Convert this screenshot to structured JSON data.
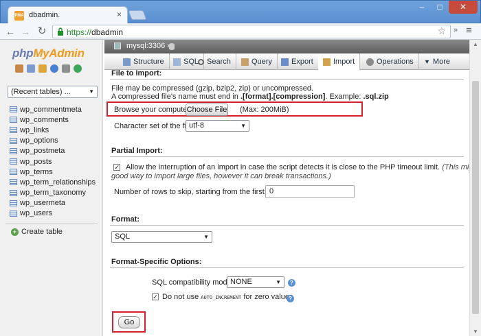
{
  "browser": {
    "tab_title": "dbadmin.",
    "tab_favicon_text": "PMA",
    "url_scheme": "https://",
    "url_host": "dbadmin"
  },
  "sidebar": {
    "logo_php": "php",
    "logo_my": "My",
    "logo_admin": "Admin",
    "recent_tables": "(Recent tables) ...",
    "tables": [
      "wp_commentmeta",
      "wp_comments",
      "wp_links",
      "wp_options",
      "wp_postmeta",
      "wp_posts",
      "wp_terms",
      "wp_term_relationships",
      "wp_term_taxonomy",
      "wp_usermeta",
      "wp_users"
    ],
    "create_table": "Create table"
  },
  "server_bar": {
    "server": "mysql:3306 »"
  },
  "tabs": [
    {
      "label": "Structure"
    },
    {
      "label": "SQL"
    },
    {
      "label": "Search"
    },
    {
      "label": "Query"
    },
    {
      "label": "Export"
    },
    {
      "label": "Import"
    },
    {
      "label": "Operations"
    },
    {
      "label": "More"
    }
  ],
  "file_import": {
    "title": "File to Import:",
    "compression_note": "File may be compressed (gzip, bzip2, zip) or uncompressed.",
    "name_note_prefix": "A compressed file's name must end in ",
    "name_note_pattern": ".[format].[compression]",
    "name_note_example_prefix": ". Example: ",
    "name_note_example": ".sql.zip",
    "browse_label": "Browse your computer:",
    "choose_file": "Choose File",
    "max_size": "(Max: 200MiB)",
    "charset_label": "Character set of the file:",
    "charset_value": "utf-8"
  },
  "partial_import": {
    "title": "Partial Import:",
    "allow_interrupt": "Allow the interruption of an import in case the script detects it is close to the PHP timeout limit.",
    "allow_interrupt_hint_1": "(This might be a",
    "allow_interrupt_hint_2": "good way to import large files, however it can break transactions.)",
    "allow_interrupt_checked": true,
    "skip_rows_label": "Number of rows to skip, starting from the first row:",
    "skip_rows_value": "0"
  },
  "format": {
    "title": "Format:",
    "value": "SQL"
  },
  "format_options": {
    "title": "Format-Specific Options:",
    "compat_label": "SQL compatibility mode:",
    "compat_value": "NONE",
    "auto_inc_prefix": "Do not use ",
    "auto_inc_code": "AUTO_INCREMENT",
    "auto_inc_suffix": " for zero values",
    "auto_inc_checked": true
  },
  "go_button": "Go",
  "colors": {
    "highlight": "#d6212c",
    "url_https": "#1a8f2a",
    "logo_blue": "#6b7cb4",
    "logo_orange": "#f29a1d"
  }
}
